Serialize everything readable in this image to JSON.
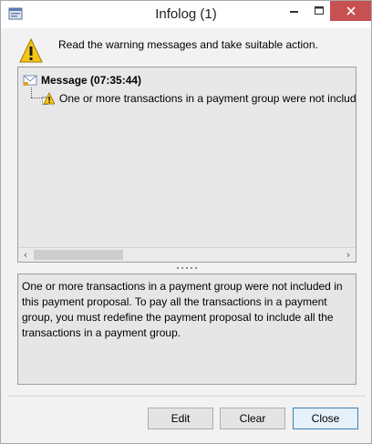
{
  "window": {
    "title": "Infolog (1)",
    "close_color": "#c75050"
  },
  "header": {
    "message": "Read the warning messages and take suitable action."
  },
  "tree": {
    "items": [
      {
        "label": "Message (07:35:44)",
        "icon": "message-icon"
      },
      {
        "label": "One or more transactions in a payment group were not included in this payment proposal.",
        "icon": "warning-icon"
      }
    ]
  },
  "detail": {
    "text": "One or more transactions in a payment group were not included in this payment proposal. To pay all the transactions in a payment group, you must redefine the payment proposal to include all the transactions in a payment group."
  },
  "buttons": {
    "edit": "Edit",
    "clear": "Clear",
    "close": "Close"
  },
  "icons": {
    "scroll_left": "‹",
    "scroll_right": "›"
  }
}
